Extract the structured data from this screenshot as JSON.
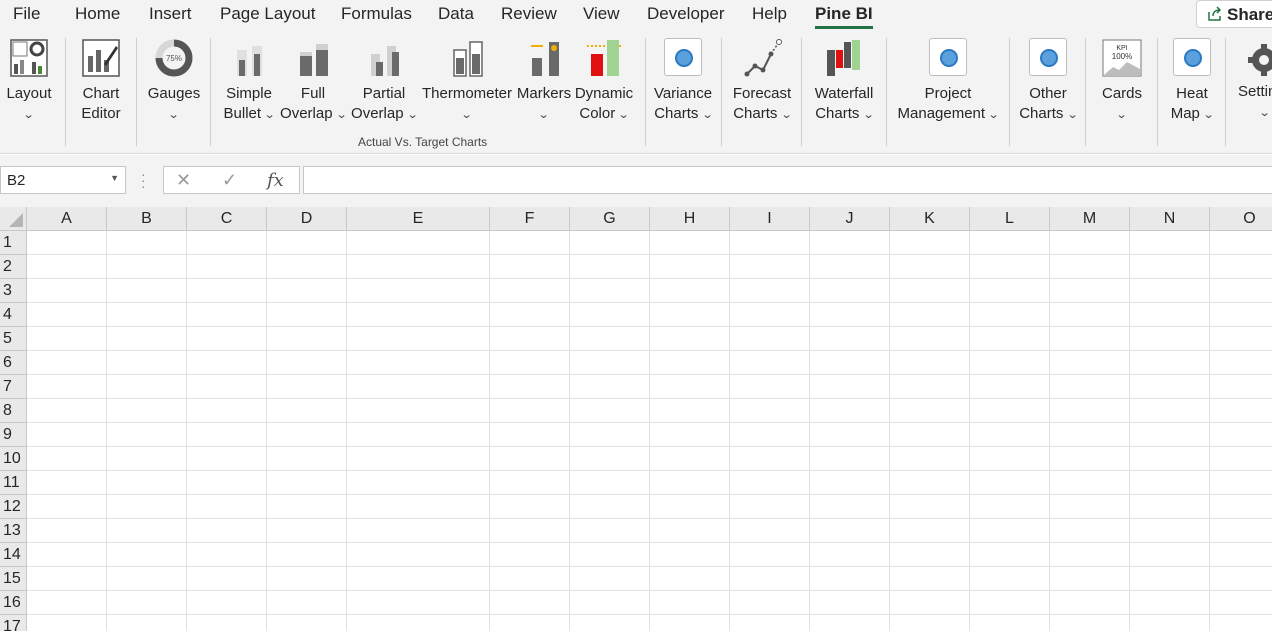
{
  "menu": {
    "tabs": [
      {
        "label": "File"
      },
      {
        "label": "Home"
      },
      {
        "label": "Insert"
      },
      {
        "label": "Page Layout"
      },
      {
        "label": "Formulas"
      },
      {
        "label": "Data"
      },
      {
        "label": "Review"
      },
      {
        "label": "View"
      },
      {
        "label": "Developer"
      },
      {
        "label": "Help"
      },
      {
        "label": "Pine BI"
      }
    ],
    "active_tab": "Pine BI",
    "share_label": "Share"
  },
  "ribbon": {
    "layout": {
      "line1": "Layout"
    },
    "chart_editor": {
      "line1": "Chart",
      "line2": "Editor"
    },
    "gauges": {
      "line1": "Gauges",
      "icon_text": "75%"
    },
    "simple_bullet": {
      "line1": "Simple",
      "line2": "Bullet"
    },
    "full_overlap": {
      "line1": "Full",
      "line2": "Overlap"
    },
    "partial_overlap": {
      "line1": "Partial",
      "line2": "Overlap"
    },
    "thermometer": {
      "line1": "Thermometer"
    },
    "markers": {
      "line1": "Markers"
    },
    "dynamic_color": {
      "line1": "Dynamic",
      "line2": "Color"
    },
    "group_actual_vs_target": "Actual Vs. Target Charts",
    "variance_charts": {
      "line1": "Variance",
      "line2": "Charts"
    },
    "forecast_charts": {
      "line1": "Forecast",
      "line2": "Charts"
    },
    "waterfall_charts": {
      "line1": "Waterfall",
      "line2": "Charts"
    },
    "project_management": {
      "line1": "Project",
      "line2": "Management"
    },
    "other_charts": {
      "line1": "Other",
      "line2": "Charts"
    },
    "cards": {
      "line1": "Cards",
      "icon_text_1": "KPI",
      "icon_text_2": "100%"
    },
    "heat_map": {
      "line1": "Heat",
      "line2": "Map"
    },
    "settings": {
      "line1": "Settin"
    }
  },
  "formula_bar": {
    "name_box": "B2",
    "cancel_glyph": "✕",
    "enter_glyph": "✓",
    "fx_glyph": "fx",
    "formula_value": ""
  },
  "grid": {
    "columns": [
      "A",
      "B",
      "C",
      "D",
      "E",
      "F",
      "G",
      "H",
      "I",
      "J",
      "K",
      "L",
      "M",
      "N",
      "O"
    ],
    "rows": [
      "1",
      "2",
      "3",
      "4",
      "5",
      "6",
      "7",
      "8",
      "9",
      "10",
      "11",
      "12",
      "13",
      "14",
      "15",
      "16",
      "17"
    ]
  },
  "colors": {
    "accent": "#217346",
    "ribbon_bg": "#f3f3f3",
    "header_bg": "#e9e9e9"
  }
}
